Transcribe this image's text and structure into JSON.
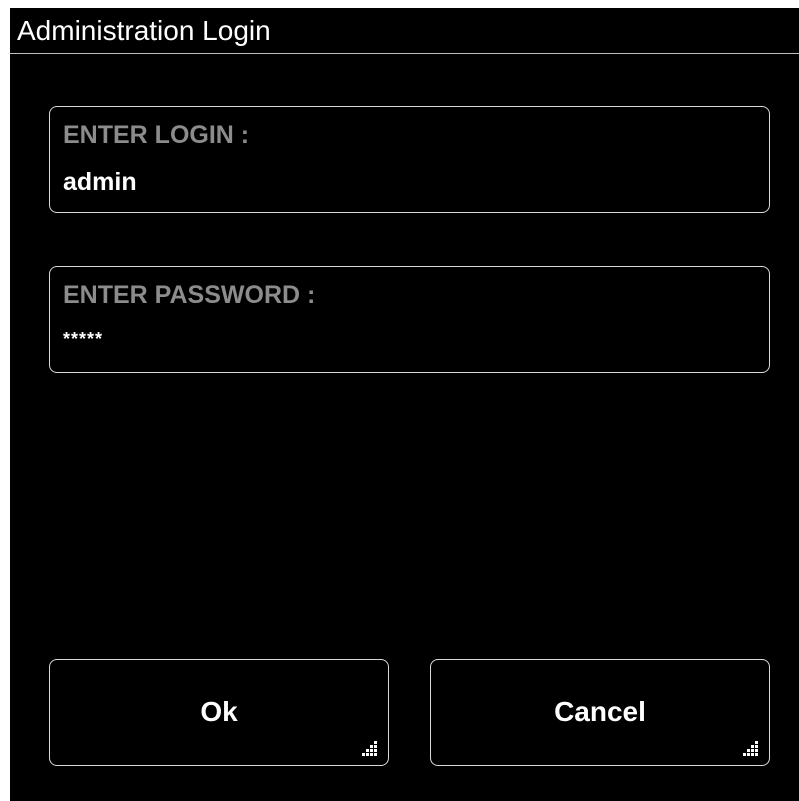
{
  "dialog": {
    "title": "Administration Login",
    "login": {
      "label": "ENTER LOGIN :",
      "value": "admin"
    },
    "password": {
      "label": "ENTER PASSWORD :",
      "value": "*****"
    },
    "buttons": {
      "ok_label": "Ok",
      "cancel_label": "Cancel"
    },
    "icons": {
      "button_corner": "resize-grip-icon"
    },
    "colors": {
      "background": "#000000",
      "text": "#ffffff",
      "label": "#8c8c8c",
      "border": "#d9d9d9"
    }
  }
}
